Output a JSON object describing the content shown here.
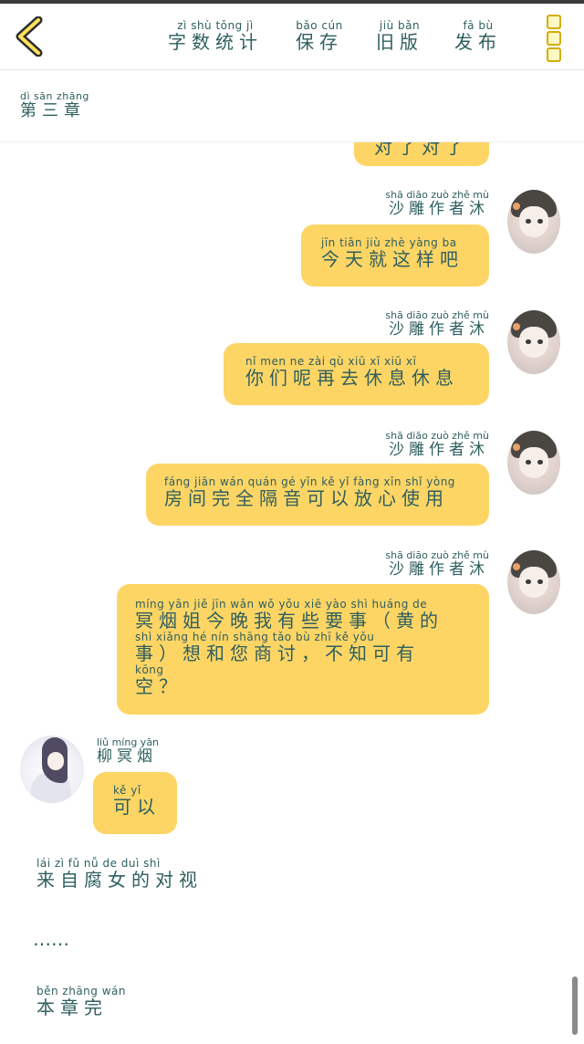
{
  "toolbar": {
    "stats": {
      "pinyin": "zì shù tǒng jì",
      "label": "字数统计"
    },
    "save": {
      "pinyin": "bǎo cún",
      "label": "保存"
    },
    "old_version": {
      "pinyin": "jiù bǎn",
      "label": "旧版"
    },
    "publish": {
      "pinyin": "fā bù",
      "label": "发布"
    },
    "accent_color": "#d4ad00"
  },
  "chapter": {
    "pinyin": "dì sān zhāng",
    "title": "第三章"
  },
  "colors": {
    "bubble": "#fdd565",
    "text": "#2f5f5f"
  },
  "messages": [
    {
      "side": "right",
      "partial": true,
      "label": "对了对了"
    },
    {
      "side": "right",
      "name_pinyin": "shā diāo zuò zhě mù",
      "name": "沙雕作者沐",
      "lines": [
        {
          "pinyin": "jīn tiān jiù zhè yàng ba",
          "text": "今天就这样吧"
        }
      ]
    },
    {
      "side": "right",
      "name_pinyin": "shā diāo zuò zhě mù",
      "name": "沙雕作者沐",
      "lines": [
        {
          "pinyin": "nǐ men ne zài qù xiū xī xiū xī",
          "text": "你们呢再去休息休息"
        }
      ]
    },
    {
      "side": "right",
      "name_pinyin": "shā diāo zuò zhě mù",
      "name": "沙雕作者沐",
      "lines": [
        {
          "pinyin": "fáng jiān wán quán gé yīn kě yǐ fàng xīn shǐ yòng",
          "text": "房间完全隔音可以放心使用"
        }
      ]
    },
    {
      "side": "right",
      "name_pinyin": "shā diāo zuò zhě mù",
      "name": "沙雕作者沐",
      "lines": [
        {
          "pinyin": "míng yān jiě jīn wǎn wǒ yǒu xiē yào shì     huáng de",
          "text": "冥烟姐今晚我有些要事（黄的"
        },
        {
          "pinyin": "shì   xiǎng hé nín shāng tǎo    bù zhī kě yǒu",
          "text": "事）想和您商讨，不知可有"
        },
        {
          "pinyin": "kōng",
          "text": "空？"
        }
      ]
    },
    {
      "side": "left",
      "name_pinyin": "liǔ míng yān",
      "name": "柳冥烟",
      "lines": [
        {
          "pinyin": "kě yǐ",
          "text": "可以"
        }
      ]
    }
  ],
  "footer_lines": [
    {
      "pinyin": "lái zì fǔ nǚ de duì shì",
      "text": "来自腐女的对视"
    },
    {
      "pinyin": "",
      "text": "……"
    },
    {
      "pinyin": "běn zhāng wán",
      "text": "本章完"
    }
  ]
}
